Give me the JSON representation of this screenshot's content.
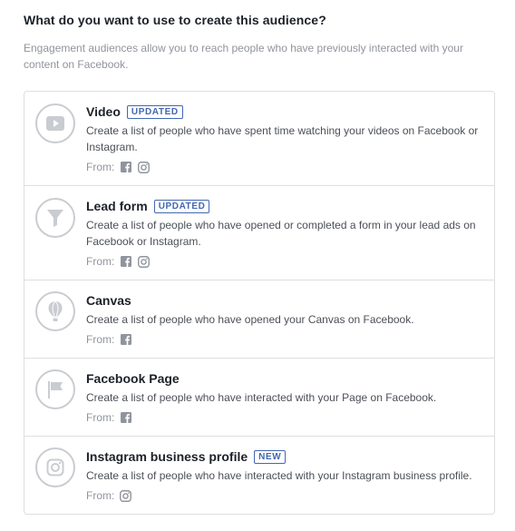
{
  "heading": "What do you want to use to create this audience?",
  "intro": "Engagement audiences allow you to reach people who have previously interacted with your content on Facebook.",
  "from_label": "From:",
  "options": [
    {
      "icon": "video-play-icon",
      "title": "Video",
      "badge": "UPDATED",
      "description": "Create a list of people who have spent time watching your videos on Facebook or Instagram.",
      "sources": [
        "facebook",
        "instagram"
      ]
    },
    {
      "icon": "funnel-icon",
      "title": "Lead form",
      "badge": "UPDATED",
      "description": "Create a list of people who have opened or completed a form in your lead ads on Facebook or Instagram.",
      "sources": [
        "facebook",
        "instagram"
      ]
    },
    {
      "icon": "hot-air-balloon-icon",
      "title": "Canvas",
      "badge": "",
      "description": "Create a list of people who have opened your Canvas on Facebook.",
      "sources": [
        "facebook"
      ]
    },
    {
      "icon": "flag-icon",
      "title": "Facebook Page",
      "badge": "",
      "description": "Create a list of people who have interacted with your Page on Facebook.",
      "sources": [
        "facebook"
      ]
    },
    {
      "icon": "instagram-icon",
      "title": "Instagram business profile",
      "badge": "NEW",
      "description": "Create a list of people who have interacted with your Instagram business profile.",
      "sources": [
        "instagram"
      ]
    }
  ],
  "colors": {
    "badge": "#4267b2",
    "icon_gray": "#c9ccd1",
    "source_icon": "#90949c",
    "border": "#dddfe2"
  }
}
